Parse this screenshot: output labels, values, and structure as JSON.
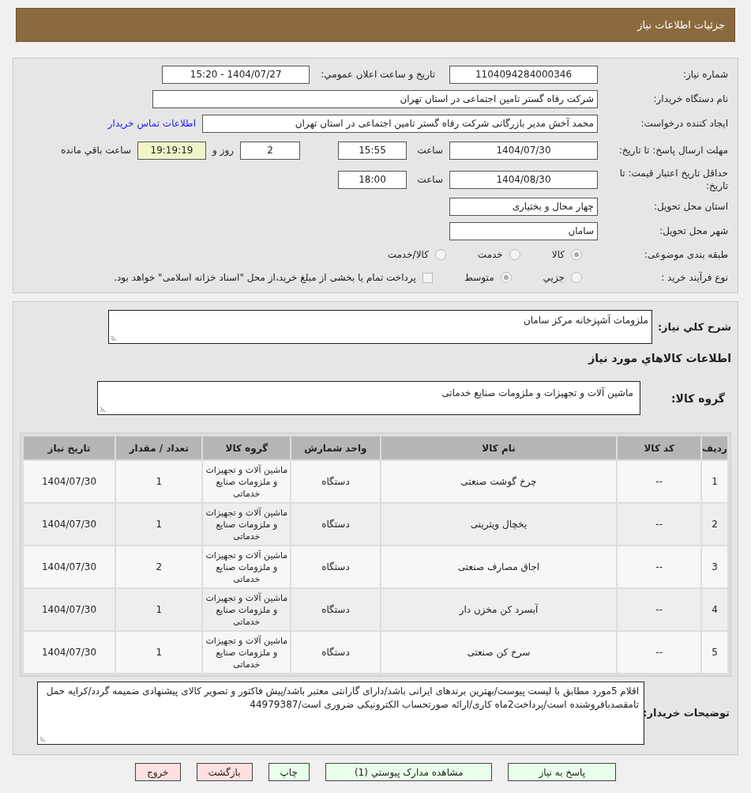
{
  "header": {
    "title": "جزئیات اطلاعات نیاز"
  },
  "details": {
    "need_number": {
      "label": "شماره نیاز:",
      "value": "1104094284000346"
    },
    "announce": {
      "label": "تاریخ و ساعت اعلان عمومي:",
      "value": "1404/07/27 - 15:20"
    },
    "buyer": {
      "label": "نام دستگاه خریدار:",
      "value": "شرکت رفاه گستر تامین اجتماعی در استان تهران"
    },
    "requester": {
      "label": "ایجاد کننده درخواست:",
      "value": "محمد آخش مدیر بازرگانی شرکت رفاه گستر تامین اجتماعی در استان تهران",
      "link": "اطلاعات تماس خریدار"
    },
    "deadline": {
      "label": "مهلت ارسال پاسخ: تا تاریخ:",
      "date": "1404/07/30",
      "time_label": "ساعت",
      "time": "15:55",
      "days": "2",
      "days_label": "روز و",
      "remaining": "19:19:19",
      "remaining_label": "ساعت باقي مانده"
    },
    "validity": {
      "label": "حداقل تاریخ اعتبار قیمت: تا تاریخ:",
      "date": "1404/08/30",
      "time_label": "ساعت",
      "time": "18:00"
    },
    "province": {
      "label": "استان محل تحویل:",
      "value": "چهار محال و بختیاری"
    },
    "city": {
      "label": "شهر محل تحویل:",
      "value": "سامان"
    },
    "category": {
      "label": "طبقه بندی موضوعی:",
      "options": [
        {
          "label": "کالا",
          "selected": true
        },
        {
          "label": "خدمت",
          "selected": false
        },
        {
          "label": "کالا/خدمت",
          "selected": false
        }
      ]
    },
    "process": {
      "label": "نوع فرآیند خرید :",
      "options": [
        {
          "label": "جزيي",
          "selected": false
        },
        {
          "label": "متوسط",
          "selected": true
        }
      ],
      "payment": {
        "label": "پرداخت تمام یا بخشی از مبلغ خرید،از محل \"اسناد خزانه اسلامی\" خواهد بود.",
        "checked": false
      }
    }
  },
  "summary": {
    "label": "شرح کلي نیاز:",
    "value": "ملزومات آشپزخانه مرکز سامان"
  },
  "goods_title": "اطلاعات کالاهاي مورد نیاز",
  "goods_group": {
    "label": "گروه کالا:",
    "value": "ماشین آلات و تجهیزات و ملزومات صنایع خدماتی"
  },
  "table": {
    "columns": [
      "ردیف",
      "کد کالا",
      "نام کالا",
      "واحد شمارش",
      "گروه کالا",
      "تعداد / مقدار",
      "تاریخ نیاز"
    ],
    "rows": [
      [
        "1",
        "--",
        "چرخ گوشت صنعتی",
        "دستگاه",
        "ماشین آلات و تجهیزات و ملزومات صنایع خدماتی",
        "1",
        "1404/07/30"
      ],
      [
        "2",
        "--",
        "یخچال ویترینی",
        "دستگاه",
        "ماشین آلات و تجهیزات و ملزومات صنایع خدماتی",
        "1",
        "1404/07/30"
      ],
      [
        "3",
        "--",
        "اجاق مصارف صنعتی",
        "دستگاه",
        "ماشین آلات و تجهیزات و ملزومات صنایع خدماتی",
        "2",
        "1404/07/30"
      ],
      [
        "4",
        "--",
        "آبسرد کن مخزن دار",
        "دستگاه",
        "ماشین آلات و تجهیزات و ملزومات صنایع خدماتی",
        "1",
        "1404/07/30"
      ],
      [
        "5",
        "--",
        "سرخ کن صنعتی",
        "دستگاه",
        "ماشین آلات و تجهیزات و ملزومات صنایع خدماتی",
        "1",
        "1404/07/30"
      ]
    ]
  },
  "buyer_notes": {
    "label": "توضیحات خریدار:",
    "value": "اقلام 5مورد مطابق با لیست پیوست/بهترین برندهای ایرانی باشد/دارای گارانتی معتبر باشد/پیش فاکتور و تصویر کالای پیشنهادی ضمیمه گردد/کرایه حمل تامقصدبافروشنده است/پرداخت2ماه کاری/ارائه صورتحساب الکترونیکی ضروری است/44979387"
  },
  "buttons": [
    {
      "label": "پاسخ به نیاز",
      "kind": "green"
    },
    {
      "label": "مشاهده مدارک پیوستي (1)",
      "kind": "green"
    },
    {
      "label": "چاپ",
      "kind": "green"
    },
    {
      "label": "بازگشت",
      "kind": "red"
    },
    {
      "label": "خروج",
      "kind": "red"
    }
  ]
}
